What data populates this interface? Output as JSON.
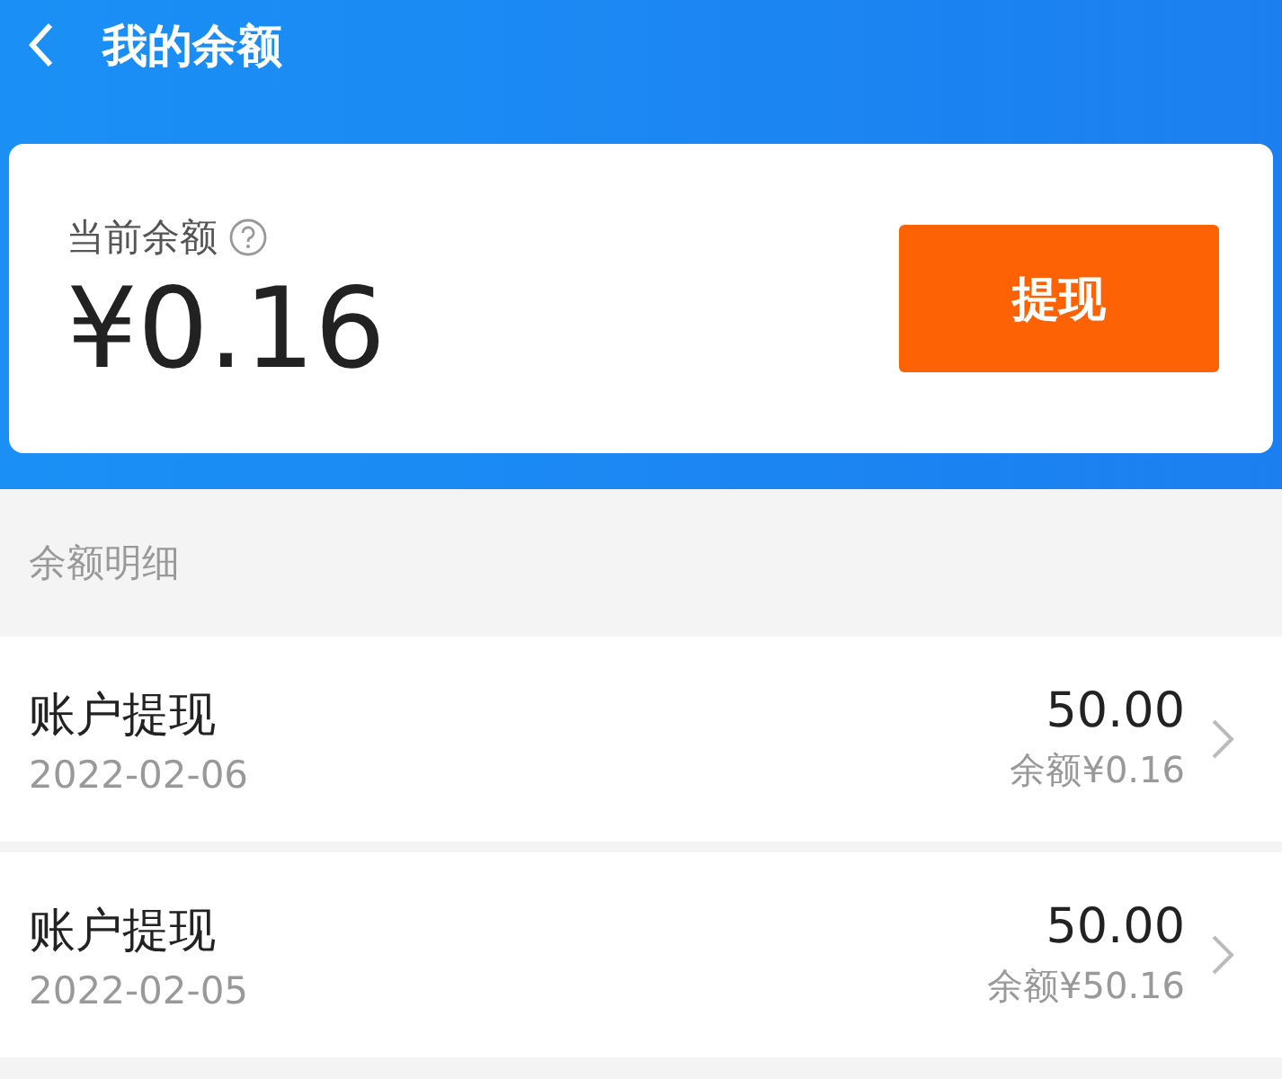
{
  "header": {
    "title": "我的余额"
  },
  "balance_card": {
    "label": "当前余额",
    "amount": "¥0.16",
    "button": "提现"
  },
  "section_title": "余额明细",
  "records": [
    {
      "title": "账户提现",
      "date": "2022-02-06",
      "amount": "50.00",
      "balance": "余额¥0.16"
    },
    {
      "title": "账户提现",
      "date": "2022-02-05",
      "amount": "50.00",
      "balance": "余额¥50.16"
    }
  ]
}
